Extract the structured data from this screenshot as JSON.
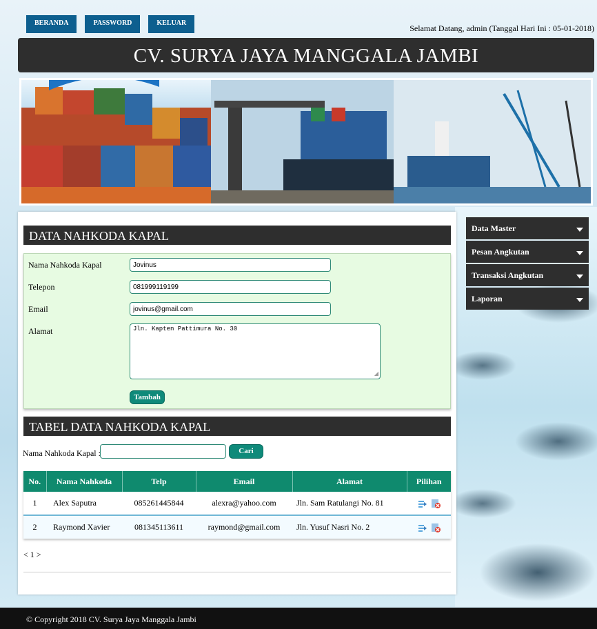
{
  "nav": {
    "items": [
      "BERANDA",
      "PASSWORD",
      "KELUAR"
    ],
    "welcome": "Selamat Datang, admin (Tanggal Hari Ini : 05-01-2018)"
  },
  "header": {
    "title": "CV. SURYA JAYA MANGGALA JAMBI"
  },
  "form": {
    "heading": "DATA NAHKODA KAPAL",
    "name_label": "Nama Nahkoda Kapal",
    "name_value": "Jovinus",
    "phone_label": "Telepon",
    "phone_value": "081999119199",
    "email_label": "Email",
    "email_value": "jovinus@gmail.com",
    "address_label": "Alamat",
    "address_value": "Jln. Kapten Pattimura No. 30",
    "submit_label": "Tambah"
  },
  "table": {
    "heading": "TABEL DATA NAHKODA KAPAL",
    "search_label": "Nama Nahkoda Kapal :",
    "search_button": "Cari",
    "columns": [
      "No.",
      "Nama Nahkoda",
      "Telp",
      "Email",
      "Alamat",
      "Pilihan"
    ],
    "rows": [
      {
        "no": "1",
        "name": "Alex Saputra",
        "phone": "085261445844",
        "email": "alexra@yahoo.com",
        "address": "Jln. Sam Ratulangi No. 81"
      },
      {
        "no": "2",
        "name": "Raymond Xavier",
        "phone": "081345113611",
        "email": "raymond@gmail.com",
        "address": "Jln. Yusuf Nasri No. 2"
      }
    ],
    "pager": "< 1 >"
  },
  "sidebar": {
    "items": [
      "Data Master",
      "Pesan Angkutan",
      "Transaksi Angkutan",
      "Laporan"
    ]
  },
  "footer": {
    "text": "© Copyright 2018 CV. Surya Jaya Manggala Jambi"
  },
  "colors": {
    "nav_button": "#0d5f8f",
    "dark_bar": "#2e2e2e",
    "accent_green": "#0f8a6e",
    "form_bg": "#e7fbe2"
  },
  "icons": [
    "edit-icon",
    "delete-icon",
    "chevron-down-icon"
  ]
}
